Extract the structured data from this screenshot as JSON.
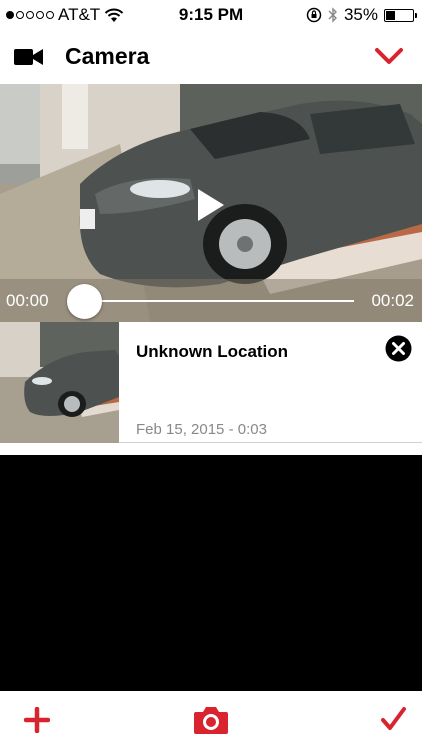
{
  "status_bar": {
    "carrier": "AT&T",
    "time": "9:15 PM",
    "battery": "35%",
    "battery_level": 0.35,
    "signal_bars": 1,
    "icons": [
      "wifi-icon",
      "rotation-lock-icon",
      "bluetooth-icon",
      "battery-icon"
    ]
  },
  "header": {
    "title": "Camera",
    "left_icon": "video-camera-icon",
    "right_icon": "chevron-down-icon"
  },
  "video": {
    "current_time": "00:00",
    "duration": "00:02",
    "progress": 0,
    "play_icon": "play-icon"
  },
  "card": {
    "location": "Unknown Location",
    "date": "Feb 15, 2015 - 0:03",
    "close_icon": "close-circle-icon"
  },
  "toolbar": {
    "left_icon": "plus-icon",
    "center_icon": "camera-icon",
    "right_icon": "checkmark-icon"
  },
  "colors": {
    "accent": "#d9232e",
    "text": "#000000",
    "secondary_text": "#888888"
  }
}
